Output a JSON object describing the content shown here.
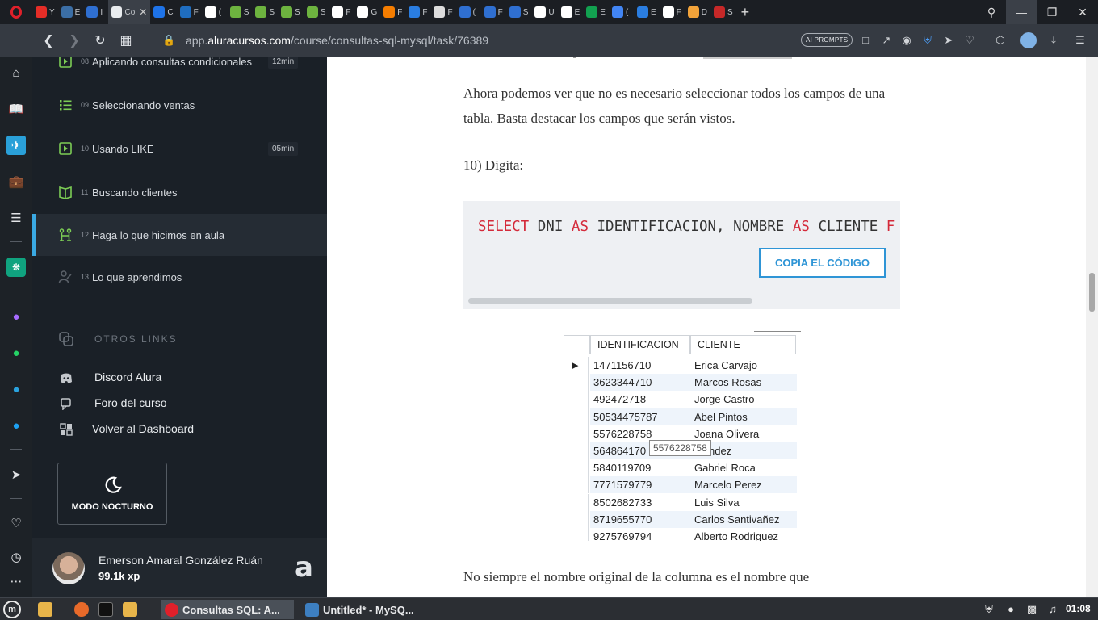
{
  "browser": {
    "tabs": [
      {
        "icon": "youtube-icon",
        "color": "#e52d27",
        "label": "Y"
      },
      {
        "icon": "bug-icon",
        "color": "#3b6ea5",
        "label": "E"
      },
      {
        "icon": "alura-icon",
        "color": "#2f6fd1",
        "label": "I"
      },
      {
        "icon": "alura-active-icon",
        "color": "#e9ecef",
        "label": "Co",
        "active": true
      },
      {
        "icon": "c-icon",
        "color": "#1e73e8",
        "label": "C"
      },
      {
        "icon": "trello-icon",
        "color": "#1f6dbf",
        "label": "F"
      },
      {
        "icon": "github-icon",
        "color": "#ffffff",
        "label": "("
      },
      {
        "icon": "spring-icon",
        "color": "#6db33f",
        "label": "S"
      },
      {
        "icon": "spring-icon",
        "color": "#6db33f",
        "label": "S"
      },
      {
        "icon": "spring-icon",
        "color": "#6db33f",
        "label": "S"
      },
      {
        "icon": "spring-icon",
        "color": "#6db33f",
        "label": "S"
      },
      {
        "icon": "page-icon",
        "color": "#ffffff",
        "label": "F"
      },
      {
        "icon": "google-icon",
        "color": "#ffffff",
        "label": "G"
      },
      {
        "icon": "blogger-icon",
        "color": "#f57d00",
        "label": "F"
      },
      {
        "icon": "edge-icon",
        "color": "#2a7de1",
        "label": "F"
      },
      {
        "icon": "pattern-icon",
        "color": "#dddddd",
        "label": "F"
      },
      {
        "icon": "alura-icon",
        "color": "#2f6fd1",
        "label": "("
      },
      {
        "icon": "alura-icon",
        "color": "#2f6fd1",
        "label": "F"
      },
      {
        "icon": "alura-icon",
        "color": "#2f6fd1",
        "label": "S"
      },
      {
        "icon": "globe-icon",
        "color": "#ffffff",
        "label": "U"
      },
      {
        "icon": "wiki-icon",
        "color": "#ffffff",
        "label": "E"
      },
      {
        "icon": "vector-icon",
        "color": "#12a150",
        "label": "E"
      },
      {
        "icon": "docs-icon",
        "color": "#4285f4",
        "label": "("
      },
      {
        "icon": "dots-icon",
        "color": "#2a7de1",
        "label": "E"
      },
      {
        "icon": "globe-icon",
        "color": "#ffffff",
        "label": "F"
      },
      {
        "icon": "chrome-icon",
        "color": "#f2a33a",
        "label": "D"
      },
      {
        "icon": "shield-icon",
        "color": "#c62828",
        "label": "S"
      }
    ],
    "url_prefix": "app.",
    "url_domain": "aluracursos.com",
    "url_path": "/course/consultas-sql-mysql/task/76389",
    "ai_prompts": "AI PROMPTS"
  },
  "course": {
    "lessons": [
      {
        "num": "08",
        "title": "Aplicando consultas condicionales",
        "time": "12min",
        "icon": "video-icon"
      },
      {
        "num": "09",
        "title": "Seleccionando ventas",
        "time": "",
        "icon": "list-icon"
      },
      {
        "num": "10",
        "title": "Usando LIKE",
        "time": "05min",
        "icon": "video-icon"
      },
      {
        "num": "11",
        "title": "Buscando clientes",
        "time": "",
        "icon": "book-icon"
      },
      {
        "num": "12",
        "title": "Haga lo que hicimos en aula",
        "time": "",
        "icon": "practice-icon",
        "active": true
      },
      {
        "num": "13",
        "title": "Lo que aprendimos",
        "time": "",
        "icon": "learned-icon"
      }
    ],
    "otros_title": "OTROS LINKS",
    "links": [
      {
        "label": "Discord Alura",
        "icon": "discord-icon"
      },
      {
        "label": "Foro del curso",
        "icon": "forum-icon"
      },
      {
        "label": "Volver al Dashboard",
        "icon": "dashboard-icon"
      }
    ],
    "night_mode": "MODO NOCTURNO",
    "profile": {
      "name": "Emerson Amaral González Ruán",
      "xp": "99.1k xp"
    }
  },
  "content": {
    "para1": "Ahora podemos ver que no es necesario seleccionar todos los campos de una tabla. Basta destacar los campos que serán vistos.",
    "step": "10) Digita:",
    "code": [
      {
        "t": "SELECT",
        "kw": true
      },
      {
        "t": " DNI ",
        "kw": false
      },
      {
        "t": "AS",
        "kw": true
      },
      {
        "t": " IDENTIFICACION, NOMBRE ",
        "kw": false
      },
      {
        "t": "AS",
        "kw": true
      },
      {
        "t": " CLIENTE ",
        "kw": false
      },
      {
        "t": "F",
        "kw": true
      }
    ],
    "copy_button": "COPIA EL CÓDIGO",
    "result": {
      "headers": [
        "IDENTIFICACION",
        "CLIENTE"
      ],
      "rows": [
        [
          "1471156710",
          "Erica Carvajo"
        ],
        [
          "3623344710",
          "Marcos Rosas"
        ],
        [
          "492472718",
          "Jorge Castro"
        ],
        [
          "50534475787",
          "Abel Pintos"
        ],
        [
          "5576228758",
          "Joana Olivera"
        ],
        [
          "564864170",
          "Mendez"
        ],
        [
          "5840119709",
          "Gabriel Roca"
        ],
        [
          "7771579779",
          "Marcelo Perez"
        ],
        [
          "8502682733",
          "Luis Silva"
        ],
        [
          "8719655770",
          "Carlos Santivañez"
        ],
        [
          "9275769794",
          "Alberto Rodriguez"
        ]
      ],
      "tooltip": "5576228758"
    },
    "para2": "No siempre el nombre original de la columna es el nombre que"
  },
  "taskbar": {
    "items": [
      {
        "label": "Consultas SQL: A...",
        "icon": "opera-icon",
        "active": true
      },
      {
        "label": "Untitled* - MySQ...",
        "icon": "mysql-workbench-icon"
      }
    ],
    "clock": "01:08"
  },
  "colors": {
    "accent": "#3aa9e3",
    "alura_green": "#7ccd55",
    "sql_keyword": "#d42a3a",
    "copy_btn": "#2f95d6"
  }
}
